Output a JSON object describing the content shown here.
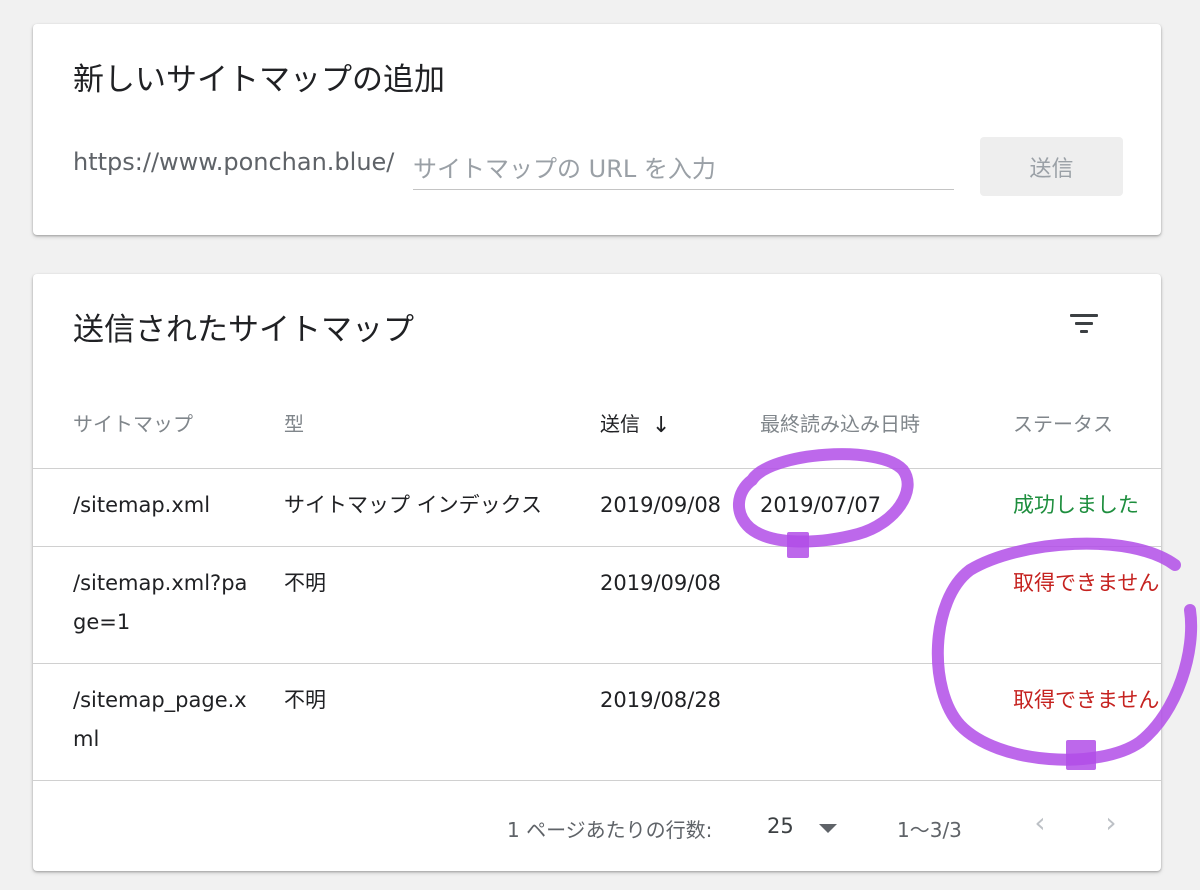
{
  "add_card": {
    "title": "新しいサイトマップの追加",
    "url_prefix": "https://www.ponchan.blue/",
    "input_placeholder": "サイトマップの URL を入力",
    "input_value": "",
    "submit_label": "送信"
  },
  "list_card": {
    "title": "送信されたサイトマップ",
    "filter_icon": "filter-icon",
    "columns": {
      "sitemap": "サイトマップ",
      "type": "型",
      "submitted": "送信",
      "last_read": "最終読み込み日時",
      "status": "ステータス"
    },
    "sort_icon": "arrow-down-icon",
    "rows": [
      {
        "sitemap": "/sitemap.xml",
        "type": "サイトマップ インデックス",
        "submitted": "2019/09/08",
        "last_read": "2019/07/07",
        "status": "成功しました"
      },
      {
        "sitemap": "/sitemap.xml?page=1",
        "type": "不明",
        "submitted": "2019/09/08",
        "last_read": "",
        "status": "取得できません"
      },
      {
        "sitemap": "/sitemap_page.xml",
        "type": "不明",
        "submitted": "2019/08/28",
        "last_read": "",
        "status": "取得できません"
      }
    ],
    "pagination": {
      "rows_per_page_label": "1 ページあたりの行数:",
      "rows_per_page": "25",
      "range": "1〜3/3",
      "prev_icon": "chevron-left-icon",
      "next_icon": "chevron-right-icon"
    }
  },
  "colors": {
    "status_success": "#1e8e3e",
    "status_error": "#c5221f",
    "annotation": "#b14ee8"
  }
}
